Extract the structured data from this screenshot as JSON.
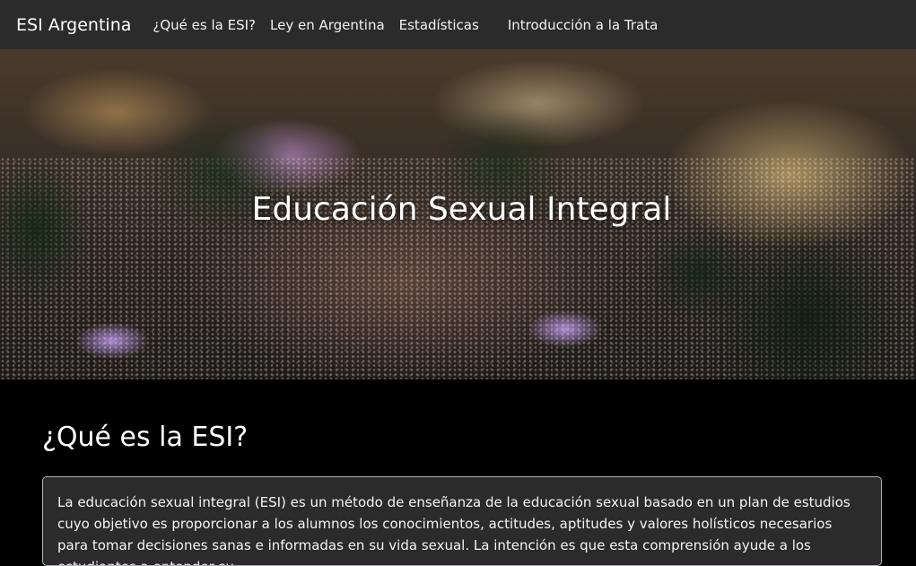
{
  "navbar": {
    "brand": "ESI Argentina",
    "links": [
      "¿Qué es la ESI?",
      "Ley en Argentina",
      "Estadísticas",
      "Introducción a la Trata"
    ]
  },
  "hero": {
    "title": "Educación Sexual Integral"
  },
  "section": {
    "title": "¿Qué es la ESI?",
    "text": "La educación sexual integral (ESI) es un método de enseñanza de la educación sexual basado en un plan de estudios cuyo objetivo es proporcionar a los alumnos los conocimientos, actitudes, aptitudes y valores holísticos necesarios para tomar decisiones sanas e informadas en su vida sexual. La intención es que esta comprensión ayude a los estudiantes a entender su"
  },
  "colors": {
    "navbar_bg": "#2b2b2b",
    "page_bg": "#000000",
    "card_bg": "#2b2b2b",
    "card_border": "#a9b7b9"
  }
}
